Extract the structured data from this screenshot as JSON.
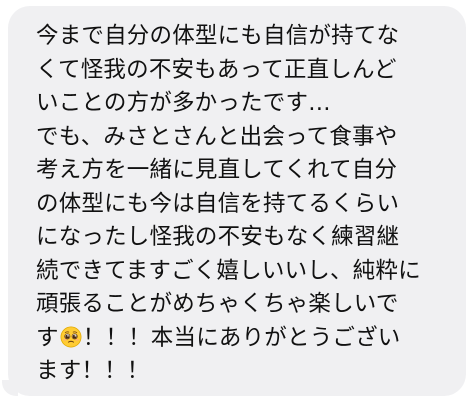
{
  "message": {
    "lines": [
      "今まで自分の体型にも自信が持てな",
      "くて怪我の不安もあって正直しんど",
      "いことの方が多かったです…",
      "でも、みさとさんと出会って食事や",
      "考え方を一緒に見直してくれて自分",
      "の体型にも今は自信を持てるくらい",
      "になったし怪我の不安もなく練習継",
      "続できてますごく嬉しいいし、純粋に",
      "頑張ることがめちゃくちゃ楽しいで"
    ],
    "line_10_before_emoji": "す",
    "line_10_after_emoji": "！！！本当にありがとうござい",
    "line_11": "ます！！！",
    "emoji_icon": "pleading-face-icon"
  },
  "colors": {
    "bubble": "#f0f0f2",
    "text": "#111111",
    "background": "#ffffff"
  }
}
